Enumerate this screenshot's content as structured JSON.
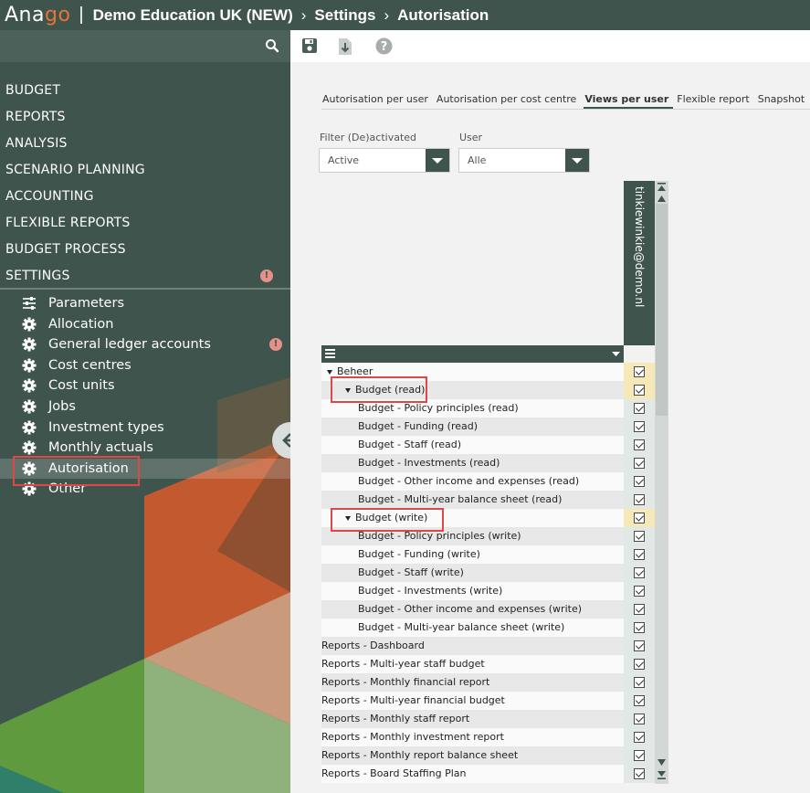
{
  "topbar": {
    "logo_prefix": "Ana",
    "logo_suffix": "go",
    "separator": "|",
    "breadcrumb": [
      "Demo Education UK (NEW)",
      "Settings",
      "Autorisation"
    ],
    "chevron": "›"
  },
  "sidebar": {
    "menu": [
      {
        "label": "BUDGET"
      },
      {
        "label": "REPORTS"
      },
      {
        "label": "ANALYSIS"
      },
      {
        "label": "SCENARIO PLANNING"
      },
      {
        "label": "ACCOUNTING"
      },
      {
        "label": "FLEXIBLE REPORTS"
      },
      {
        "label": "BUDGET PROCESS"
      },
      {
        "label": "SETTINGS",
        "alert": "!"
      }
    ],
    "submenu": [
      {
        "label": "Parameters",
        "icon": "sliders-icon"
      },
      {
        "label": "Allocation",
        "icon": "gear-icon"
      },
      {
        "label": "General ledger accounts",
        "icon": "gear-icon",
        "alert": "!"
      },
      {
        "label": "Cost centres",
        "icon": "gear-icon"
      },
      {
        "label": "Cost units",
        "icon": "gear-icon"
      },
      {
        "label": "Jobs",
        "icon": "gear-icon"
      },
      {
        "label": "Investment types",
        "icon": "gear-icon"
      },
      {
        "label": "Monthly actuals",
        "icon": "gear-icon"
      },
      {
        "label": "Autorisation",
        "icon": "gear-icon",
        "active": true
      },
      {
        "label": "Other",
        "icon": "gear-icon"
      }
    ]
  },
  "tabs": [
    {
      "label": "Autorisation per user"
    },
    {
      "label": "Autorisation per cost centre"
    },
    {
      "label": "Views per user",
      "active": true
    },
    {
      "label": "Flexible report"
    },
    {
      "label": "Snapshot"
    }
  ],
  "filters": {
    "activated_label": "Filter (De)activated",
    "activated_value": "Active",
    "user_label": "User",
    "user_value": "Alle"
  },
  "grid": {
    "column_user": "tinkiewinkie@demo.nl",
    "rows": [
      {
        "label": "Beheer",
        "level": 0,
        "expand": true,
        "highlight": true
      },
      {
        "label": "Budget (read)",
        "level": 1,
        "expand": true,
        "highlight": true
      },
      {
        "label": "Budget - Policy principles (read)",
        "level": 2
      },
      {
        "label": "Budget - Funding (read)",
        "level": 2
      },
      {
        "label": "Budget - Staff (read)",
        "level": 2
      },
      {
        "label": "Budget - Investments (read)",
        "level": 2
      },
      {
        "label": "Budget - Other income and expenses (read)",
        "level": 2
      },
      {
        "label": "Budget - Multi-year balance sheet (read)",
        "level": 2
      },
      {
        "label": "Budget (write)",
        "level": 1,
        "expand": true,
        "highlight": true
      },
      {
        "label": "Budget - Policy principles (write)",
        "level": 2
      },
      {
        "label": "Budget - Funding (write)",
        "level": 2
      },
      {
        "label": "Budget - Staff (write)",
        "level": 2
      },
      {
        "label": "Budget - Investments (write)",
        "level": 2
      },
      {
        "label": "Budget - Other income and expenses (write)",
        "level": 2
      },
      {
        "label": "Budget - Multi-year balance sheet (write)",
        "level": 2
      },
      {
        "label": "Reports - Dashboard",
        "level": -1
      },
      {
        "label": "Reports - Multi-year staff budget",
        "level": -1
      },
      {
        "label": "Reports - Monthly financial report",
        "level": -1
      },
      {
        "label": "Reports - Multi-year financial budget",
        "level": -1
      },
      {
        "label": "Reports - Monthly staff report",
        "level": -1
      },
      {
        "label": "Reports - Monthly investment report",
        "level": -1
      },
      {
        "label": "Reports - Monthly report balance sheet",
        "level": -1
      },
      {
        "label": "Reports - Board Staffing Plan",
        "level": -1
      }
    ]
  },
  "colors": {
    "sidebar": "#3f544d",
    "accent_orange": "#e8733a",
    "highlight_box": "#e04848",
    "checkbox_highlight": "#f6e9b7"
  }
}
